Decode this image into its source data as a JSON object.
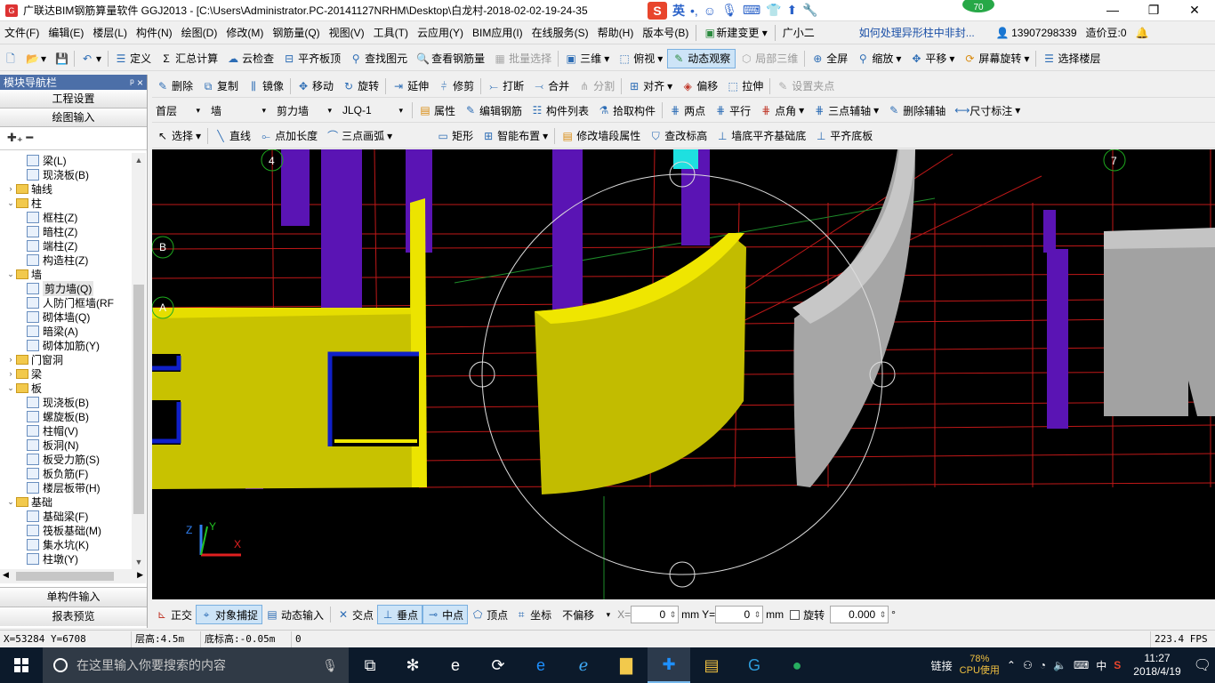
{
  "title": "广联达BIM钢筋算量软件 GGJ2013 - [C:\\Users\\Administrator.PC-20141127NRHM\\Desktop\\白龙村-2018-02-02-19-24-35",
  "ime": {
    "mode": "英",
    "badge": "70"
  },
  "menu": [
    "文件(F)",
    "编辑(E)",
    "楼层(L)",
    "构件(N)",
    "绘图(D)",
    "修改(M)",
    "钢筋量(Q)",
    "视图(V)",
    "工具(T)",
    "云应用(Y)",
    "BIM应用(I)",
    "在线服务(S)",
    "帮助(H)",
    "版本号(B)",
    "新建变更",
    "广小二",
    "如何处理异形柱中非封...",
    "13907298339",
    "造价豆:0"
  ],
  "toolbar1": {
    "define": "定义",
    "sum": "汇总计算",
    "cloud_check": "云检查",
    "flush_top": "平齐板顶",
    "find": "查找图元",
    "view_rebar": "查看钢筋量",
    "batch_select": "批量选择",
    "view3d": "三维",
    "top_view": "俯视",
    "dynamic": "动态观察",
    "local3d": "局部三维",
    "fullscreen": "全屏",
    "zoom": "缩放",
    "pan": "平移",
    "rotate_screen": "屏幕旋转",
    "select_floor": "选择楼层"
  },
  "toolbar2": {
    "delete": "删除",
    "copy": "复制",
    "mirror": "镜像",
    "move": "移动",
    "rotate": "旋转",
    "extend": "延伸",
    "trim": "修剪",
    "break": "打断",
    "merge": "合并",
    "split": "分割",
    "align": "对齐",
    "offset": "偏移",
    "stretch": "拉伸",
    "set_point": "设置夹点"
  },
  "toolbar3": {
    "floor": "首层",
    "category": "墙",
    "type": "剪力墙",
    "member": "JLQ-1",
    "props": "属性",
    "edit_rebar": "编辑钢筋",
    "member_list": "构件列表",
    "pick": "拾取构件",
    "two_point": "两点",
    "parallel": "平行",
    "corner": "点角",
    "three_point_aux": "三点辅轴",
    "delete_aux": "删除辅轴",
    "dim": "尺寸标注"
  },
  "toolbar4": {
    "select": "选择",
    "line": "直线",
    "point_len": "点加长度",
    "arc3": "三点画弧",
    "rect": "矩形",
    "smart": "智能布置",
    "modify_seg": "修改墙段属性",
    "check_elev": "查改标高",
    "flush_base": "墙底平齐基础底",
    "flush_slab": "平齐底板"
  },
  "left": {
    "header": "模块导航栏",
    "pin": "ᵖ ×",
    "proj": "工程设置",
    "draw": "绘图输入",
    "tools": "✚₊ ━",
    "single": "单构件输入",
    "report": "报表预览",
    "tree": [
      {
        "lvl": 2,
        "t": "梁(L)",
        "k": "item"
      },
      {
        "lvl": 2,
        "t": "现浇板(B)",
        "k": "item"
      },
      {
        "lvl": 1,
        "t": "轴线",
        "k": "folder",
        "ex": "›"
      },
      {
        "lvl": 1,
        "t": "柱",
        "k": "folder",
        "ex": "⌄"
      },
      {
        "lvl": 2,
        "t": "框柱(Z)",
        "k": "item"
      },
      {
        "lvl": 2,
        "t": "暗柱(Z)",
        "k": "item"
      },
      {
        "lvl": 2,
        "t": "端柱(Z)",
        "k": "item"
      },
      {
        "lvl": 2,
        "t": "构造柱(Z)",
        "k": "item"
      },
      {
        "lvl": 1,
        "t": "墙",
        "k": "folder",
        "ex": "⌄"
      },
      {
        "lvl": 2,
        "t": "剪力墙(Q)",
        "k": "item",
        "sel": true
      },
      {
        "lvl": 2,
        "t": "人防门框墙(RF",
        "k": "item"
      },
      {
        "lvl": 2,
        "t": "砌体墙(Q)",
        "k": "item"
      },
      {
        "lvl": 2,
        "t": "暗梁(A)",
        "k": "item"
      },
      {
        "lvl": 2,
        "t": "砌体加筋(Y)",
        "k": "item"
      },
      {
        "lvl": 1,
        "t": "门窗洞",
        "k": "folder",
        "ex": "›"
      },
      {
        "lvl": 1,
        "t": "梁",
        "k": "folder",
        "ex": "›"
      },
      {
        "lvl": 1,
        "t": "板",
        "k": "folder",
        "ex": "⌄"
      },
      {
        "lvl": 2,
        "t": "现浇板(B)",
        "k": "item"
      },
      {
        "lvl": 2,
        "t": "螺旋板(B)",
        "k": "item"
      },
      {
        "lvl": 2,
        "t": "柱帽(V)",
        "k": "item"
      },
      {
        "lvl": 2,
        "t": "板洞(N)",
        "k": "item"
      },
      {
        "lvl": 2,
        "t": "板受力筋(S)",
        "k": "item"
      },
      {
        "lvl": 2,
        "t": "板负筋(F)",
        "k": "item"
      },
      {
        "lvl": 2,
        "t": "楼层板带(H)",
        "k": "item"
      },
      {
        "lvl": 1,
        "t": "基础",
        "k": "folder",
        "ex": "⌄"
      },
      {
        "lvl": 2,
        "t": "基础梁(F)",
        "k": "item"
      },
      {
        "lvl": 2,
        "t": "筏板基础(M)",
        "k": "item"
      },
      {
        "lvl": 2,
        "t": "集水坑(K)",
        "k": "item"
      },
      {
        "lvl": 2,
        "t": "柱墩(Y)",
        "k": "item"
      }
    ]
  },
  "canvas": {
    "axis_labels": [
      "4",
      "7",
      "B",
      "A"
    ],
    "axes": {
      "x": "X",
      "y": "Y",
      "z": "Z"
    }
  },
  "status": {
    "ortho": "正交",
    "snap": "对象捕捉",
    "dyn_input": "动态输入",
    "intersect": "交点",
    "perp": "垂点",
    "mid": "中点",
    "vertex": "顶点",
    "coord": "坐标",
    "offset_mode": "不偏移",
    "x_label": "X=",
    "x_val": "0",
    "unit1": "mm",
    "y_label": "Y=",
    "y_val": "0",
    "unit2": "mm",
    "rotate_label": "旋转",
    "rotate_val": "0.000",
    "deg": "°"
  },
  "info": {
    "coords": "X=53284 Y=6708",
    "floor_h": "层高:4.5m",
    "base_h": "底标高:-0.05m",
    "zero": "0",
    "fps": "223.4 FPS"
  },
  "taskbar": {
    "search": "在这里输入你要搜索的内容",
    "link": "链接",
    "cpu_pct": "78%",
    "cpu_label": "CPU使用",
    "lang": "中",
    "time": "11:27",
    "date": "2018/4/19"
  }
}
